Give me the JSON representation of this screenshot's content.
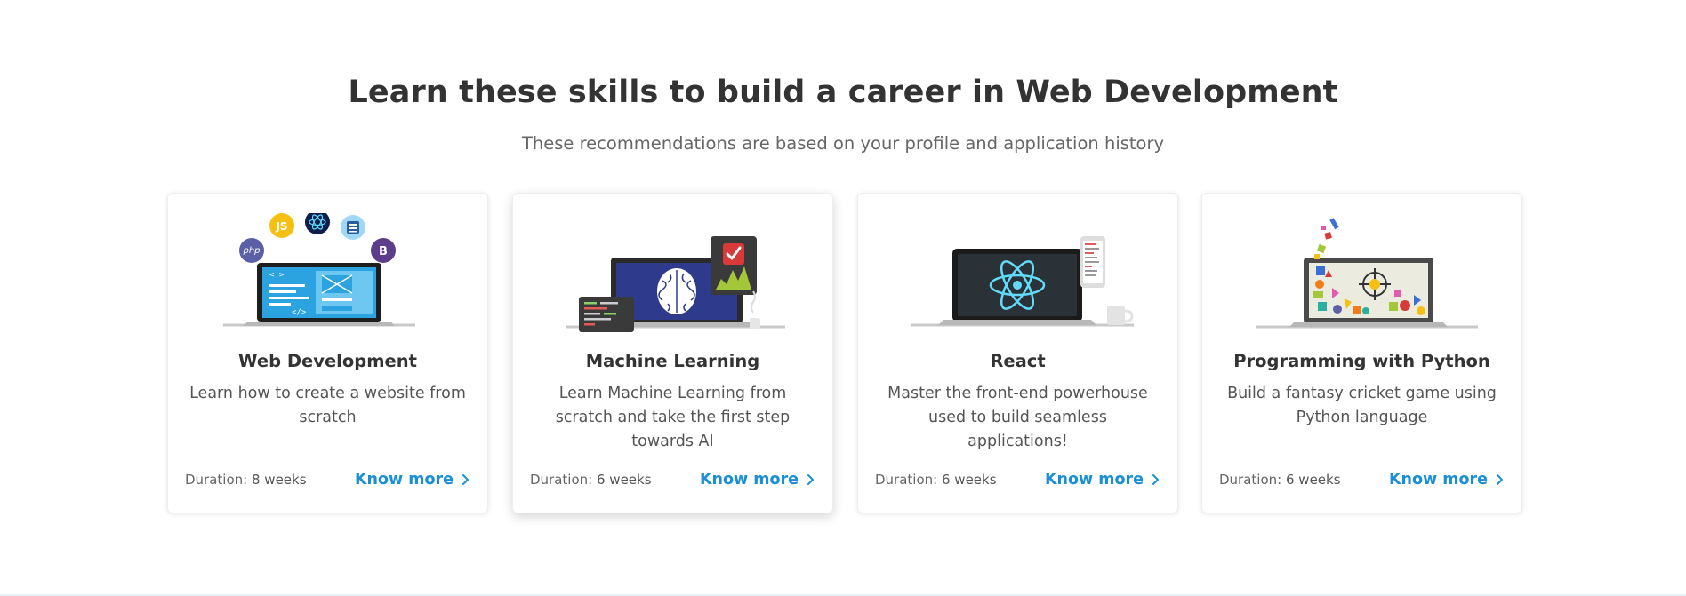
{
  "section": {
    "heading": "Learn these skills to build a career in Web Development",
    "subheading": "These recommendations are based on your profile and application history"
  },
  "cards": [
    {
      "title": "Web Development",
      "description": "Learn how to create a website from scratch",
      "duration_label": "Duration:",
      "duration_value": "8 weeks",
      "cta": "Know more",
      "illustration": "laptop-code-icon",
      "badges": {
        "php": "php",
        "js": "JS",
        "bootstrap": "B"
      }
    },
    {
      "title": "Machine Learning",
      "description": "Learn Machine Learning from scratch and take the first step towards AI",
      "duration_label": "Duration:",
      "duration_value": "6 weeks",
      "cta": "Know more",
      "illustration": "brain-laptop-icon"
    },
    {
      "title": "React",
      "description": "Master the front-end powerhouse used to build seamless applications!",
      "duration_label": "Duration:",
      "duration_value": "6 weeks",
      "cta": "Know more",
      "illustration": "react-atom-laptop-icon"
    },
    {
      "title": "Programming with Python",
      "description": "Build a fantasy cricket game using Python language",
      "duration_label": "Duration:",
      "duration_value": "6 weeks",
      "cta": "Know more",
      "illustration": "python-game-laptop-icon"
    }
  ],
  "colors": {
    "accent": "#1a8fd6",
    "heading": "#333333",
    "muted": "#666666"
  }
}
